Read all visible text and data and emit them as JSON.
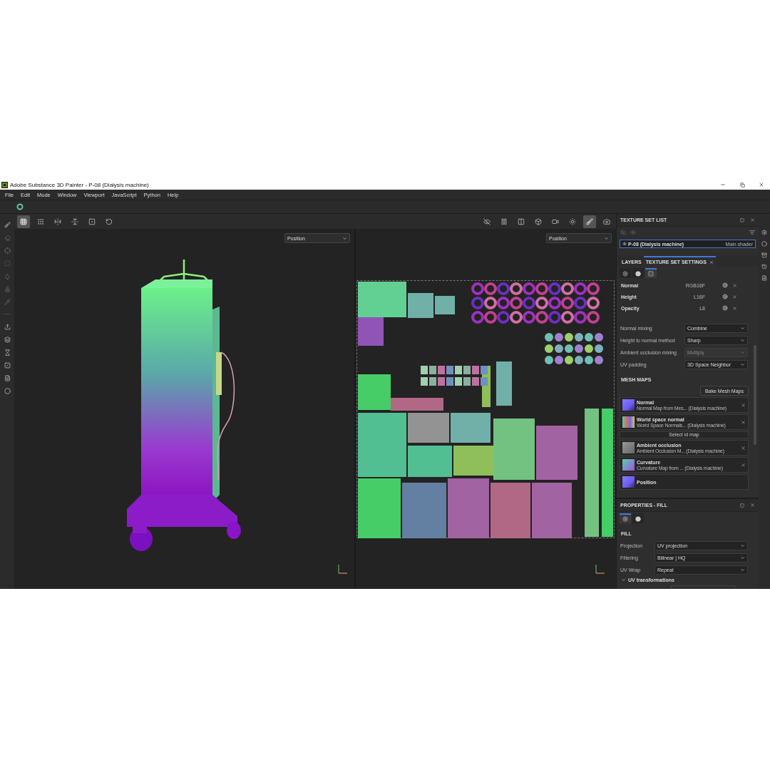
{
  "window": {
    "title": "Adobe Substance 3D Painter - P-08 (Dialysis machine)"
  },
  "menu": [
    "File",
    "Edit",
    "Mode",
    "Window",
    "Viewport",
    "JavaScript",
    "Python",
    "Help"
  ],
  "left_tools": [
    {
      "kind": "brush"
    },
    {
      "kind": "eraser"
    },
    {
      "kind": "projection"
    },
    {
      "kind": "polyfill"
    },
    {
      "kind": "smudge"
    },
    {
      "kind": "clone"
    },
    {
      "kind": "picker"
    },
    {
      "kind": "sep"
    },
    {
      "kind": "export"
    },
    {
      "kind": "bake"
    },
    {
      "kind": "hourglass"
    },
    {
      "kind": "uv"
    },
    {
      "kind": "doc"
    },
    {
      "kind": "mask"
    }
  ],
  "viewport_toolbar_left": [
    {
      "kind": "grid",
      "selected": true
    },
    {
      "kind": "gridmore",
      "selected": false
    },
    {
      "kind": "mirrorx",
      "selected": false
    },
    {
      "kind": "mirrory",
      "selected": false
    },
    {
      "kind": "frame",
      "selected": false
    },
    {
      "kind": "reset",
      "selected": false
    }
  ],
  "viewport_toolbar_right": [
    {
      "kind": "hide",
      "selected": false
    },
    {
      "kind": "pause",
      "selected": false
    },
    {
      "kind": "split",
      "selected": false
    },
    {
      "kind": "cube",
      "selected": false
    },
    {
      "kind": "camera",
      "selected": false
    },
    {
      "kind": "light",
      "selected": false
    },
    {
      "kind": "brush",
      "selected": true
    },
    {
      "kind": "snapshot",
      "selected": false
    }
  ],
  "viewports": [
    {
      "kind": "model",
      "channel": "Position"
    },
    {
      "kind": "uv",
      "channel": "Position"
    }
  ],
  "texture_set_list": {
    "title": "TEXTURE SET LIST",
    "items": [
      {
        "name": "P-08 (Dialysis machine)",
        "shader": "Main shader",
        "selected": true
      }
    ]
  },
  "tabs": [
    {
      "label": "LAYERS",
      "selected": false,
      "closable": false
    },
    {
      "label": "TEXTURE SET SETTINGS",
      "selected": true,
      "closable": true
    }
  ],
  "channels": [
    {
      "name": "Normal",
      "format": "RGB16F"
    },
    {
      "name": "Height",
      "format": "L16F"
    },
    {
      "name": "Opacity",
      "format": "L8"
    }
  ],
  "settings": [
    {
      "label": "Normal mixing",
      "value": "Combine",
      "disabled": false
    },
    {
      "label": "Height to normal method",
      "value": "Sharp",
      "disabled": false
    },
    {
      "label": "Ambient occlusion mixing",
      "value": "Multiply",
      "disabled": true
    },
    {
      "label": "UV padding",
      "value": "3D Space Neighbor",
      "disabled": false
    }
  ],
  "mesh_maps": {
    "title": "MESH MAPS",
    "bake_button": "Bake Mesh Maps",
    "items": [
      {
        "kind": "map",
        "name": "Normal",
        "source": "Normal Map from Mes... (Dialysis machine)"
      },
      {
        "kind": "map",
        "name": "World space normal",
        "source": "World Space Normals... (Dialysis machine)"
      },
      {
        "kind": "button",
        "name": "Select id map"
      },
      {
        "kind": "map",
        "name": "Ambient occlusion",
        "source": "Ambient Occlusion M... (Dialysis machine)"
      },
      {
        "kind": "map",
        "name": "Curvature",
        "source": "Curvature Map from ... (Dialysis machine)"
      },
      {
        "kind": "map",
        "name": "Position"
      }
    ]
  },
  "properties": {
    "title": "PROPERTIES - FILL",
    "section": "FILL",
    "fields": [
      {
        "label": "Projection",
        "value": "UV projection"
      },
      {
        "label": "Filtering",
        "value": "Bilinear | HQ"
      },
      {
        "label": "UV Wrap",
        "value": "Repeat"
      }
    ],
    "group": {
      "label": "UV transformations",
      "expanded": true
    }
  }
}
